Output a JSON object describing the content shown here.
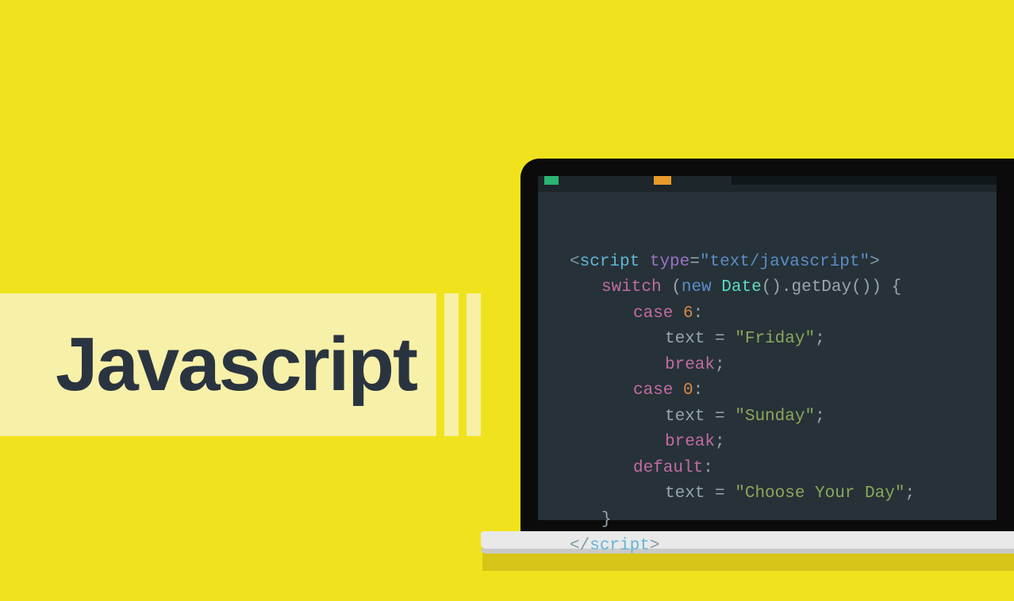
{
  "title": "Javascript",
  "code": {
    "l1": {
      "open": "<",
      "tag": "script",
      "sp": " ",
      "attr": "type",
      "eq": "=",
      "val": "\"text/javascript\"",
      "close": ">"
    },
    "l2": {
      "kw": "switch",
      "paren": " (",
      "newkw": "new",
      "sp": " ",
      "cls": "Date",
      "call": "().",
      "method": "getDay",
      "tail": "()) {"
    },
    "l3": {
      "kw": "case",
      "sp": " ",
      "num": "6",
      "colon": ":"
    },
    "l4": {
      "id": "text",
      "op": " = ",
      "str": "\"Friday\"",
      "semi": ";"
    },
    "l5": {
      "kw": "break",
      "semi": ";"
    },
    "l6": {
      "kw": "case",
      "sp": " ",
      "num": "0",
      "colon": ":"
    },
    "l7": {
      "id": "text",
      "op": " = ",
      "str": "\"Sunday\"",
      "semi": ";"
    },
    "l8": {
      "kw": "break",
      "semi": ";"
    },
    "l9": {
      "kw": "default",
      "colon": ":"
    },
    "l10": {
      "id": "text",
      "op": " = ",
      "str": "\"Choose Your Day\"",
      "semi": ";"
    },
    "l11": {
      "brace": "}"
    },
    "l12": {
      "open": "</",
      "tag": "script",
      "close": ">"
    }
  }
}
